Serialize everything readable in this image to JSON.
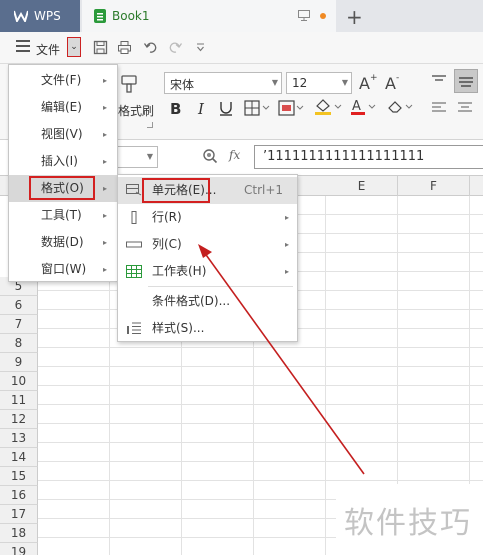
{
  "titlebar": {
    "app": "WPS",
    "document": "Book1"
  },
  "menubar": {
    "file_label": "文件",
    "dropdown_glyph": "⌄"
  },
  "ribbon": {
    "font_name": "宋体",
    "font_size": "12",
    "format_painter": "格式刷"
  },
  "formula_bar": {
    "fx": "fx",
    "value": "’1111111111111111111"
  },
  "columns": [
    "E",
    "F"
  ],
  "rows": [
    "5",
    "6",
    "7",
    "8",
    "9",
    "10",
    "11",
    "12",
    "13",
    "14",
    "15",
    "16",
    "17",
    "18",
    "19"
  ],
  "main_menu": [
    {
      "label": "文件(F)"
    },
    {
      "label": "编辑(E)"
    },
    {
      "label": "视图(V)"
    },
    {
      "label": "插入(I)"
    },
    {
      "label": "格式(O)"
    },
    {
      "label": "工具(T)"
    },
    {
      "label": "数据(D)"
    },
    {
      "label": "窗口(W)"
    }
  ],
  "format_submenu": [
    {
      "label": "单元格(E)...",
      "shortcut": "Ctrl+1"
    },
    {
      "label": "行(R)"
    },
    {
      "label": "列(C)"
    },
    {
      "label": "工作表(H)"
    },
    {
      "label": "条件格式(D)..."
    },
    {
      "label": "样式(S)..."
    }
  ],
  "watermark": "软件技巧",
  "colors": {
    "highlight_red": "#d32020",
    "wps_tab": "#5a6e8e",
    "book_green": "#2b9a3b"
  }
}
